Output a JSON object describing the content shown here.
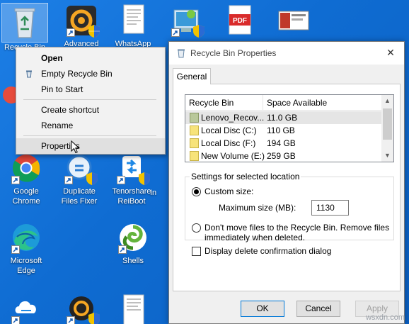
{
  "desktop": {
    "icons": [
      {
        "id": "recycle-bin",
        "label": "Recycle Bin"
      },
      {
        "id": "advanced",
        "label": "Advanced"
      },
      {
        "id": "whatsapp",
        "label": "WhatsApp"
      },
      {
        "id": "control-panel",
        "label": ""
      },
      {
        "id": "pdf",
        "label": ""
      },
      {
        "id": "screenshot-file",
        "label": ""
      },
      {
        "id": "google-chrome",
        "label": "Google Chrome"
      },
      {
        "id": "duplicate-files-fixer",
        "label": "Duplicate Files Fixer"
      },
      {
        "id": "tenorshare-reiboot",
        "label": "Tenorshare ReiBoot"
      },
      {
        "id": "microsoft-edge",
        "label": "Microsoft Edge"
      },
      {
        "id": "shells",
        "label": "Shells"
      }
    ],
    "partial_labels": {
      "left_f": "F",
      "right_in": "In"
    },
    "pdf_text": "PDF"
  },
  "context_menu": {
    "items": [
      {
        "label": "Open",
        "bold": true
      },
      {
        "label": "Empty Recycle Bin",
        "icon": "recycle-bin-icon"
      },
      {
        "label": "Pin to Start"
      },
      {
        "label": "Create shortcut"
      },
      {
        "label": "Rename"
      },
      {
        "label": "Properties",
        "hover": true
      }
    ]
  },
  "dialog": {
    "title": "Recycle Bin Properties",
    "close_glyph": "✕",
    "tab": "General",
    "list": {
      "col_location": "Recycle Bin Location",
      "col_space": "Space Available",
      "rows": [
        {
          "location": "Lenovo_Recov...",
          "space": "11.0 GB",
          "selected": true
        },
        {
          "location": "Local Disc (C:)",
          "space": "110 GB"
        },
        {
          "location": "Local Disc (F:)",
          "space": "194 GB"
        },
        {
          "location": "New Volume (E:)",
          "space": "259 GB"
        }
      ]
    },
    "settings": {
      "group_title": "Settings for selected location",
      "custom_size_label": "Custom size:",
      "max_size_label": "Maximum size (MB):",
      "max_size_value": "1130",
      "dont_move_line1": "Don't move files to the Recycle Bin. Remove files",
      "dont_move_line2": "immediately when deleted."
    },
    "confirm_label": "Display delete confirmation dialog",
    "buttons": {
      "ok": "OK",
      "cancel": "Cancel",
      "apply": "Apply"
    }
  },
  "watermark": "wsxdn.com",
  "colors": {
    "desktop_bg": "#1a73d6",
    "accent": "#0078d7"
  }
}
